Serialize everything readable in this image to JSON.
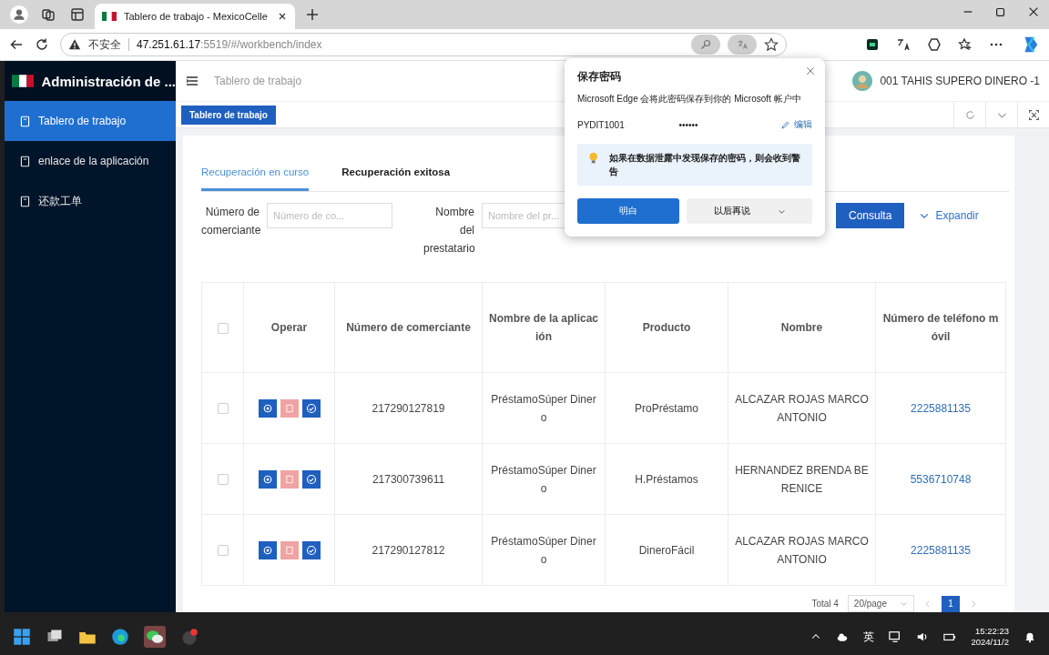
{
  "browser": {
    "tabs": [
      {
        "title": "Tablero de trabajo - MexicoCelle",
        "selected": true
      }
    ],
    "security": "不安全",
    "url_host": "47.251.61.17",
    "url_rest": ":5519/#/workbench/index"
  },
  "app": {
    "title": "Administración de ...",
    "sidebar": [
      {
        "label": "Tablero de trabajo",
        "selected": true
      },
      {
        "label": "enlace de la aplicación",
        "selected": false
      },
      {
        "label": "还款工单",
        "selected": false
      }
    ],
    "breadcrumb": "Tablero de trabajo",
    "user": "001 TAHIS SUPERO DINERO -1",
    "tags": [
      {
        "label": "Tablero de trabajo",
        "selected": true
      }
    ],
    "tabs": [
      {
        "label": "Recuperación en curso",
        "selected": true
      },
      {
        "label": "Recuperación exitosa",
        "selected": false
      }
    ],
    "filters": [
      {
        "label": "Número de comerciante",
        "placeholder": "Número de co..."
      },
      {
        "label": "Nombre del prestatario",
        "placeholder": "Nombre del pr..."
      }
    ],
    "query_button": "Consulta",
    "expand_link": "Expandir",
    "table": {
      "header_checked": false,
      "columns": [
        "Operar",
        "Número de comerciante",
        "Nombre de la aplicación",
        "Producto",
        "Nombre",
        "Número de teléfono móvil"
      ],
      "rows": [
        {
          "checked": false,
          "merchant": "217290127819",
          "app": "PréstamoSúper Dinero",
          "product": "ProPréstamo",
          "name": "ALCAZAR ROJAS MARCO ANTONIO",
          "phone": "2225881135"
        },
        {
          "checked": false,
          "merchant": "217300739611",
          "app": "PréstamoSúper Dinero",
          "product": "H.Préstamos",
          "name": "HERNANDEZ BRENDA BERENICE",
          "phone": "5536710748"
        },
        {
          "checked": false,
          "merchant": "217290127812",
          "app": "PréstamoSúper Dinero",
          "product": "DineroFácil",
          "name": "ALCAZAR ROJAS MARCO ANTONIO",
          "phone": "2225881135"
        }
      ]
    },
    "pagination": {
      "total": "Total 4",
      "page_size": "20/page",
      "pages": [
        {
          "label": "1",
          "selected": true
        }
      ]
    }
  },
  "popup": {
    "title": "保存密码",
    "message": "Microsoft Edge 会将此密码保存到你的 Microsoft 帐户中",
    "username": "PYDIT1001",
    "password": "••••••",
    "edit": "编辑",
    "warning": "如果在数据泄露中发现保存的密码，则会收到警告",
    "primary": "明白",
    "secondary": "以后再说"
  },
  "taskbar": {
    "ime": "英",
    "time": "15:22:23",
    "date": "2024/11/2"
  }
}
